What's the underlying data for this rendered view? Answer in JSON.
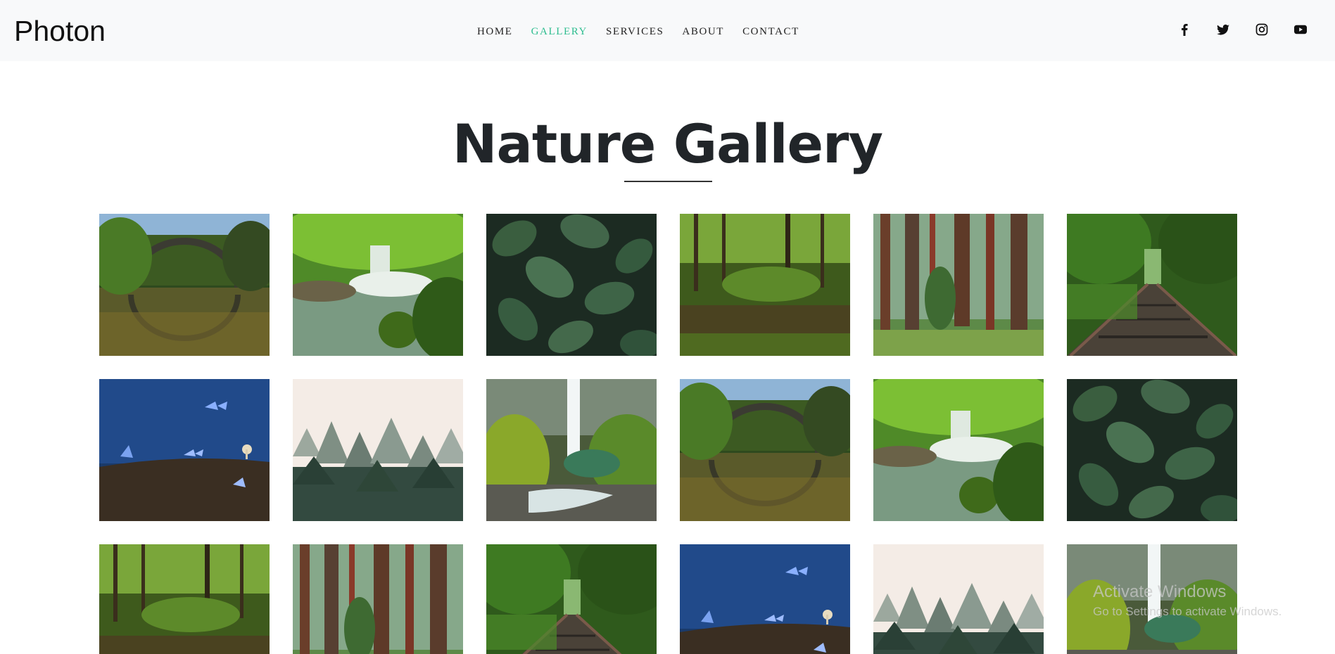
{
  "brand": "Photon",
  "nav": {
    "links": [
      {
        "label": "HOME",
        "active": false
      },
      {
        "label": "GALLERY",
        "active": true
      },
      {
        "label": "SERVICES",
        "active": false
      },
      {
        "label": "ABOUT",
        "active": false
      },
      {
        "label": "CONTACT",
        "active": false
      }
    ],
    "active_color": "#2ebd8f"
  },
  "social": [
    "facebook-icon",
    "twitter-icon",
    "instagram-icon",
    "youtube-icon"
  ],
  "page_title": "Nature Gallery",
  "gallery": {
    "images": [
      "stone-arch-bridge",
      "forest-waterfall",
      "green-leaves",
      "mossy-forest-stream",
      "redwood-forest",
      "forest-railway",
      "blue-butterflies",
      "misty-pine-forest",
      "tall-waterfall",
      "stone-arch-bridge",
      "forest-waterfall",
      "green-leaves",
      "mossy-forest-stream",
      "redwood-forest",
      "forest-railway",
      "blue-butterflies",
      "misty-pine-forest",
      "tall-waterfall"
    ]
  },
  "watermark": {
    "title": "Activate Windows",
    "subtitle": "Go to Settings to activate Windows."
  }
}
